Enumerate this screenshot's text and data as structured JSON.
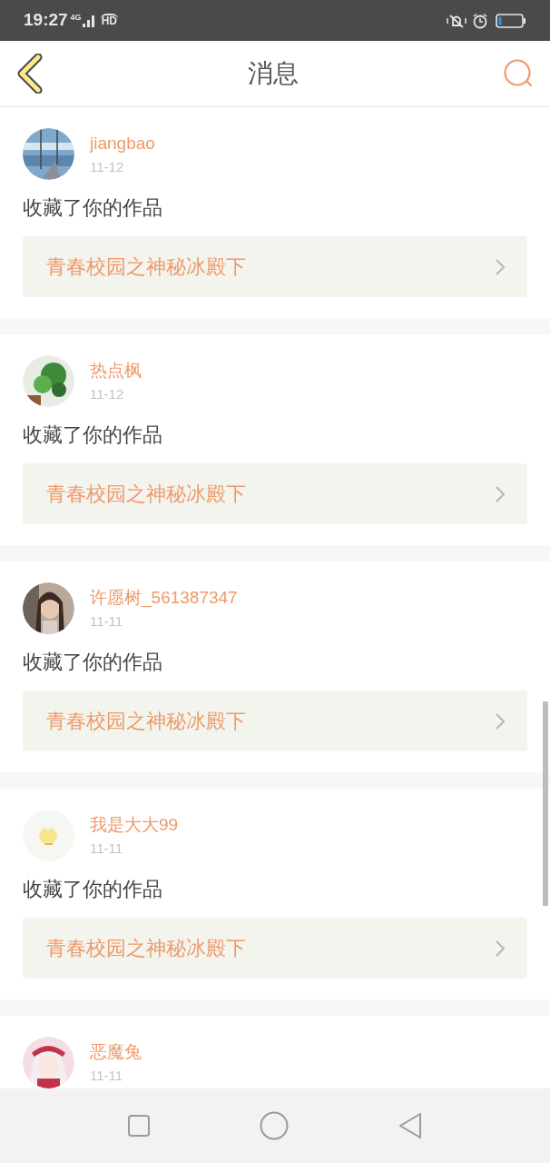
{
  "status_bar": {
    "time": "19:27",
    "network": "4G",
    "hd": "HD"
  },
  "header": {
    "title": "消息"
  },
  "messages": [
    {
      "user": "jiangbao",
      "date": "11-12",
      "action": "收藏了你的作品",
      "work": "青春校园之神秘冰殿下"
    },
    {
      "user": "热点枫",
      "date": "11-12",
      "action": "收藏了你的作品",
      "work": "青春校园之神秘冰殿下"
    },
    {
      "user": "许愿树_561387347",
      "date": "11-11",
      "action": "收藏了你的作品",
      "work": "青春校园之神秘冰殿下"
    },
    {
      "user": "我是大大99",
      "date": "11-11",
      "action": "收藏了你的作品",
      "work": "青春校园之神秘冰殿下"
    },
    {
      "user": "恶魔兔",
      "date": "11-11"
    }
  ]
}
